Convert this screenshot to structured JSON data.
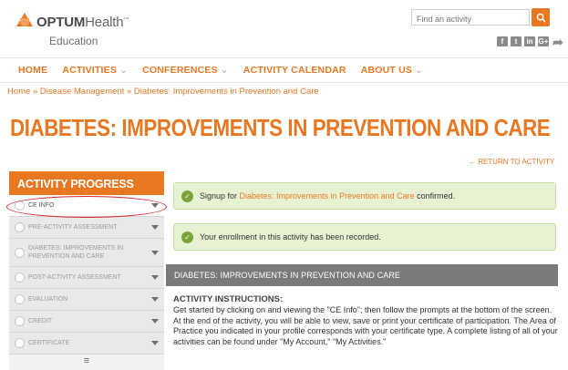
{
  "brand": {
    "name_bold": "OPTUM",
    "name_rest": "Health",
    "trademark": "™",
    "subtitle": "Education"
  },
  "search": {
    "placeholder": "Find an activity"
  },
  "social": {
    "icons": [
      "facebook-icon",
      "twitter-icon",
      "linkedin-icon",
      "google-plus-icon",
      "share-icon"
    ],
    "labels": [
      "f",
      "t",
      "in",
      "G+",
      "➦"
    ]
  },
  "nav": {
    "items": [
      {
        "label": "HOME",
        "caret": ""
      },
      {
        "label": "ACTIVITIES",
        "caret": "⌄"
      },
      {
        "label": "CONFERENCES",
        "caret": "⌄"
      },
      {
        "label": "ACTIVITY CALENDAR",
        "caret": ""
      },
      {
        "label": "ABOUT US",
        "caret": "⌄"
      }
    ]
  },
  "breadcrumb": {
    "items": [
      "Home",
      "Disease Management",
      "Diabetes: Improvements in Prevention and Care"
    ],
    "separator": "»"
  },
  "page": {
    "title": "DIABETES: IMPROVEMENTS IN PREVENTION AND CARE",
    "return_link": "← RETURN TO ACTIVITY"
  },
  "sidebar": {
    "heading": "ACTIVITY PROGRESS",
    "items": [
      {
        "label": "CE INFO",
        "active": true
      },
      {
        "label": "PRE-ACTIVITY ASSESSMENT",
        "active": false
      },
      {
        "label": "DIABETES: IMPROVEMENTS IN PREVENTION AND CARE",
        "active": false
      },
      {
        "label": "POST-ACTIVITY ASSESSMENT",
        "active": false
      },
      {
        "label": "EVALUATION",
        "active": false
      },
      {
        "label": "CREDIT",
        "active": false
      },
      {
        "label": "CERTIFICATE",
        "active": false
      }
    ],
    "menu_icon": "≡"
  },
  "alerts": {
    "signup": {
      "prefix": "Signup for ",
      "activity": "Diabetes: Improvements in Prevention and Care",
      "suffix": " confirmed."
    },
    "enrollment": "Your enrollment in this activity has been recorded."
  },
  "section": {
    "title": "DIABETES: IMPROVEMENTS IN PREVENTION AND CARE"
  },
  "instructions": {
    "title": "ACTIVITY INSTRUCTIONS:",
    "body": "Get started by clicking on and viewing the \"CE Info\"; then follow the prompts at the bottom of the screen. At the end of the activity, you will be able to view, save or print your certificate of participation. The Area of Practice you indicated in your profile corresponds with your certificate type. A complete listing of all of your activities can be found under \"My Account,\" \"My Activities.\""
  },
  "colors": {
    "accent": "#e87722",
    "success_bg": "#e7f2d2",
    "success_icon": "#7aa33a",
    "section_bar": "#7a7a7a",
    "highlight": "#d9242a"
  }
}
